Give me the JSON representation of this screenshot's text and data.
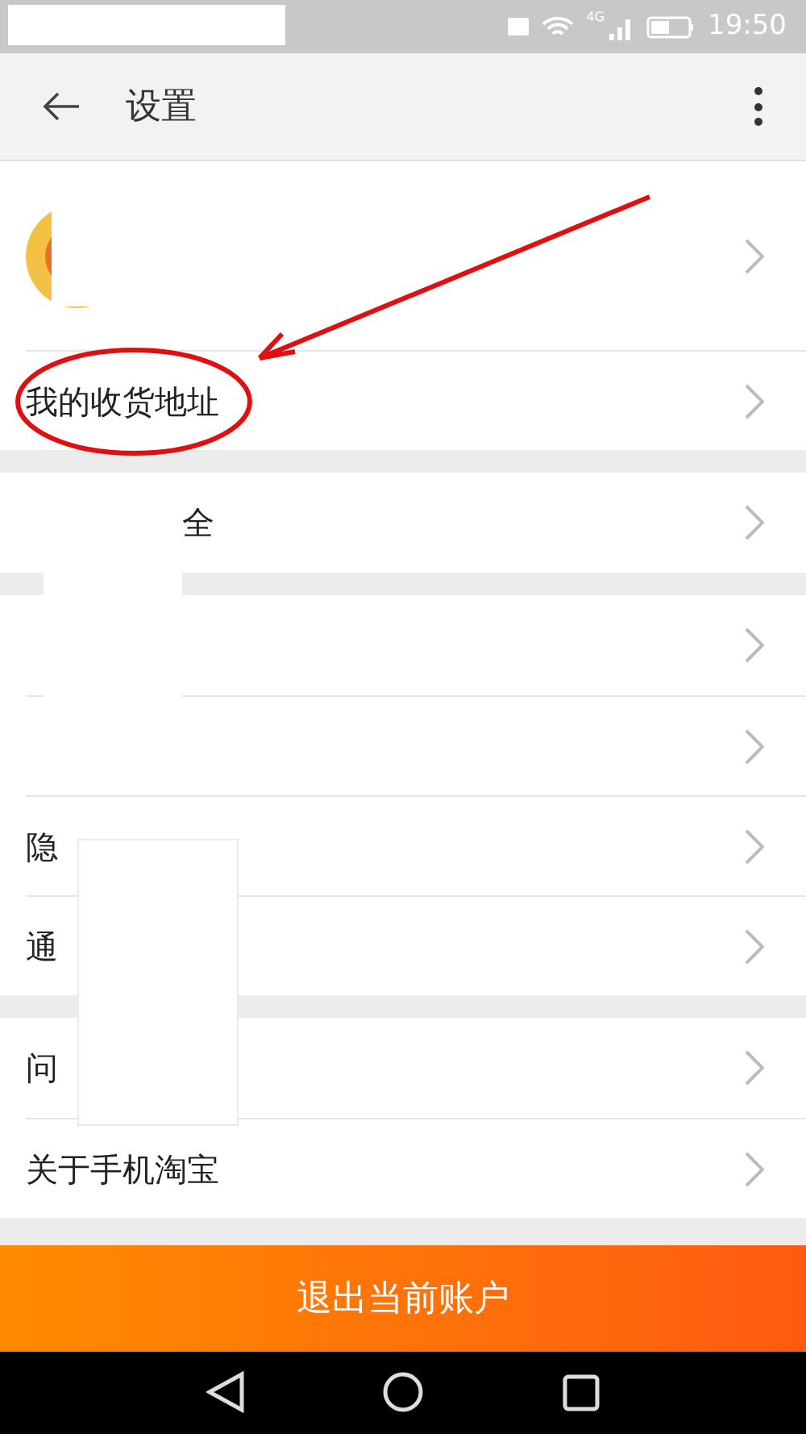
{
  "status_bar": {
    "time": "19:50",
    "network": "4G"
  },
  "header": {
    "title": "设置"
  },
  "groups": [
    [
      {
        "kind": "profile"
      },
      {
        "kind": "item",
        "label": "我的收货地址"
      }
    ],
    [
      {
        "kind": "item",
        "tail": "全"
      }
    ],
    [
      {
        "kind": "item"
      },
      {
        "kind": "item"
      },
      {
        "kind": "item",
        "label": "隐"
      },
      {
        "kind": "item",
        "label": "通"
      }
    ],
    [
      {
        "kind": "item",
        "label": "问"
      },
      {
        "kind": "item",
        "label": "关于手机淘宝"
      }
    ]
  ],
  "logout_button": "退出当前账户"
}
